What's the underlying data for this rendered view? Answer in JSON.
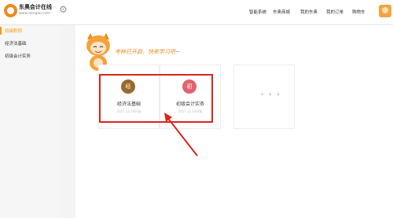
{
  "header": {
    "brand_name": "东奥会计在线",
    "brand_url": "www.dongao.com",
    "nav": [
      "智能系统",
      "东奥商城",
      "我的东奥",
      "我的订单",
      "购物车"
    ]
  },
  "sidebar": {
    "items": [
      {
        "label": "初级职称",
        "active": true
      },
      {
        "label": "经济法基础",
        "active": false
      },
      {
        "label": "初级会计实务",
        "active": false
      }
    ]
  },
  "slogan": "考种已开启，快来学习吧~",
  "cards": [
    {
      "badge": "经",
      "title": "经济法基础",
      "date": "2017.12.14开始",
      "color": "#9a6a2a"
    },
    {
      "badge": "初",
      "title": "初级会计实务",
      "date": "2017.12.14开始",
      "color": "#e1636b"
    }
  ],
  "more_card": "• • •",
  "colors": {
    "accent": "#f39800",
    "highlight": "#d9261c"
  }
}
